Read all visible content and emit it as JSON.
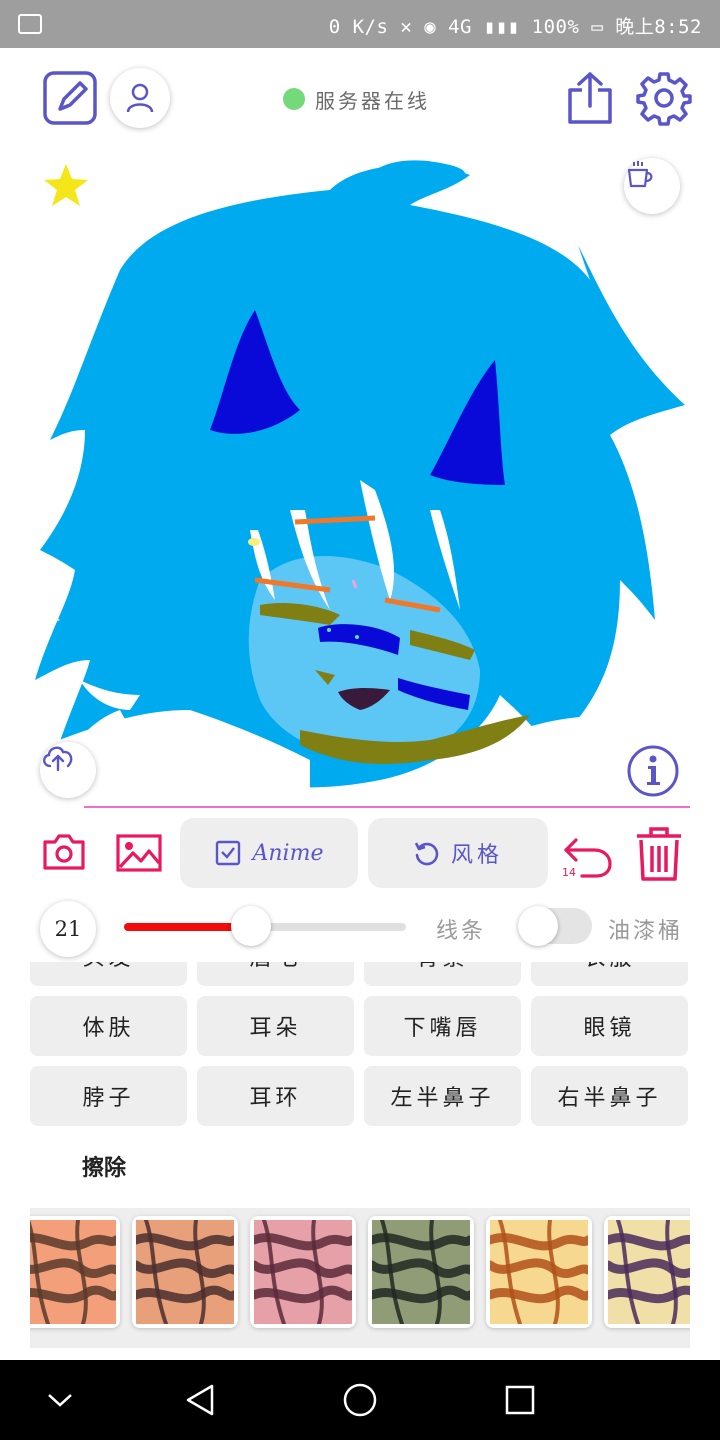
{
  "status_bar": {
    "text": "0 K/s ✕ ◉ 4G ▮▮▮ 100% ▭ 晚上8:52"
  },
  "header": {
    "server_status": "服务器在线",
    "server_color": "#74d97a"
  },
  "toolbar": {
    "anime_label": "Anime",
    "style_label": "风格",
    "undo_count": "14",
    "accent": "#5a56c9",
    "danger": "#e8195f"
  },
  "brush": {
    "size": "21",
    "size_fraction": 0.45,
    "line_label": "线条",
    "bucket_label": "油漆桶",
    "bucket_on": false
  },
  "parts": {
    "row_partial": [
      "头发",
      "眉毛",
      "背景",
      "衣服"
    ],
    "row1": [
      "体肤",
      "耳朵",
      "下嘴唇",
      "眼镜"
    ],
    "row2": [
      "脖子",
      "耳环",
      "左半鼻子",
      "右半鼻子"
    ]
  },
  "erase_label": "擦除",
  "styles": [
    {
      "name": "style-1",
      "base": "#f3a07a",
      "stroke": "#5a3a2a"
    },
    {
      "name": "style-2",
      "base": "#e8a07a",
      "stroke": "#4b2e2e"
    },
    {
      "name": "style-3",
      "base": "#e6a0a8",
      "stroke": "#5a2a3a"
    },
    {
      "name": "style-4",
      "base": "#8f9c76",
      "stroke": "#222822"
    },
    {
      "name": "style-5",
      "base": "#f6d890",
      "stroke": "#b0501a"
    },
    {
      "name": "style-6",
      "base": "#f0e0a8",
      "stroke": "#4a2a5a"
    }
  ]
}
